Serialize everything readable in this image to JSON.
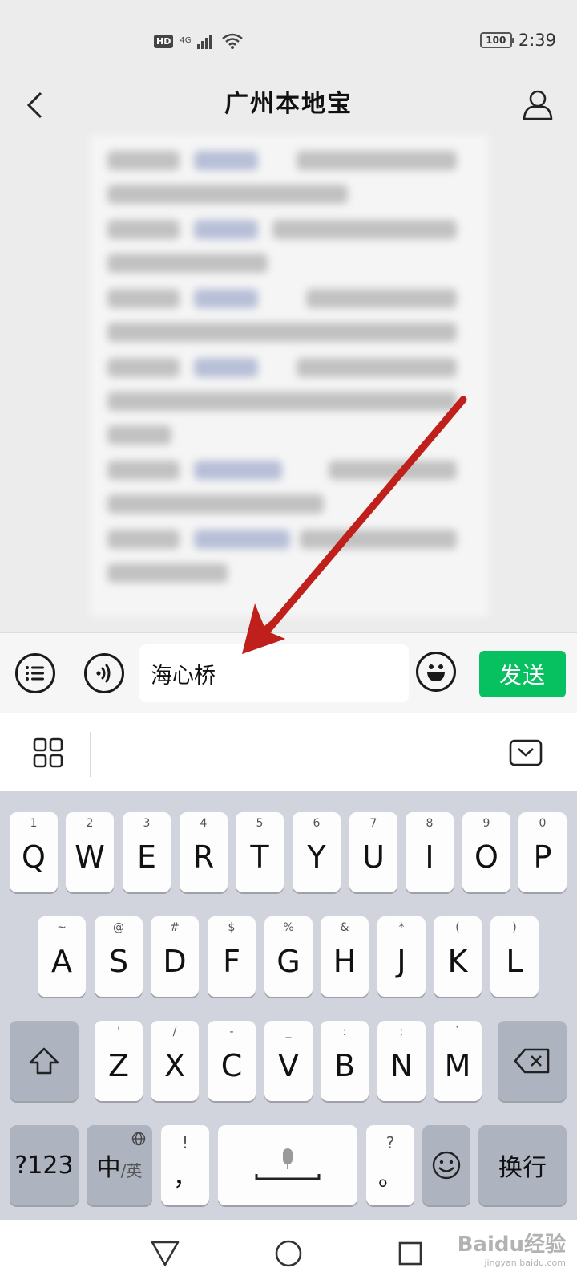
{
  "status_bar": {
    "hd": "HD",
    "network": "4G",
    "battery": "100",
    "time": "2:39"
  },
  "header": {
    "title": "广州本地宝"
  },
  "input_bar": {
    "message_value": "海心桥",
    "send_label": "发送"
  },
  "keyboard": {
    "row1": [
      {
        "hint": "1",
        "letter": "Q"
      },
      {
        "hint": "2",
        "letter": "W"
      },
      {
        "hint": "3",
        "letter": "E"
      },
      {
        "hint": "4",
        "letter": "R"
      },
      {
        "hint": "5",
        "letter": "T"
      },
      {
        "hint": "6",
        "letter": "Y"
      },
      {
        "hint": "7",
        "letter": "U"
      },
      {
        "hint": "8",
        "letter": "I"
      },
      {
        "hint": "9",
        "letter": "O"
      },
      {
        "hint": "0",
        "letter": "P"
      }
    ],
    "row2": [
      {
        "hint": "~",
        "letter": "A"
      },
      {
        "hint": "@",
        "letter": "S"
      },
      {
        "hint": "#",
        "letter": "D"
      },
      {
        "hint": "$",
        "letter": "F"
      },
      {
        "hint": "%",
        "letter": "G"
      },
      {
        "hint": "&",
        "letter": "H"
      },
      {
        "hint": "*",
        "letter": "J"
      },
      {
        "hint": "(",
        "letter": "K"
      },
      {
        "hint": ")",
        "letter": "L"
      }
    ],
    "row3": [
      {
        "hint": "'",
        "letter": "Z"
      },
      {
        "hint": "/",
        "letter": "X"
      },
      {
        "hint": "-",
        "letter": "C"
      },
      {
        "hint": "_",
        "letter": "V"
      },
      {
        "hint": ":",
        "letter": "B"
      },
      {
        "hint": ";",
        "letter": "N"
      },
      {
        "hint": "`",
        "letter": "M"
      }
    ],
    "numbers_label": "?123",
    "lang_main": "中",
    "lang_sub": "/英",
    "comma_hint": "!",
    "comma_label": "，",
    "period_hint": "?",
    "period_label": "。",
    "enter_label": "换行"
  },
  "watermark": {
    "line1": "Baidu经验",
    "line2": "jingyan.baidu.com"
  },
  "colors": {
    "send_green": "#07c160",
    "arrow_red": "#c0201b",
    "keyboard_bg": "#d1d4dc"
  },
  "icons": {
    "back": "chevron-left-icon",
    "profile": "person-icon",
    "list": "list-icon",
    "voice": "voice-icon",
    "emoji": "emoji-icon",
    "grid": "grid-icon",
    "collapse": "keyboard-collapse-icon",
    "shift": "shift-icon",
    "delete": "backspace-icon",
    "globe": "globe-icon",
    "mic": "mic-icon"
  }
}
